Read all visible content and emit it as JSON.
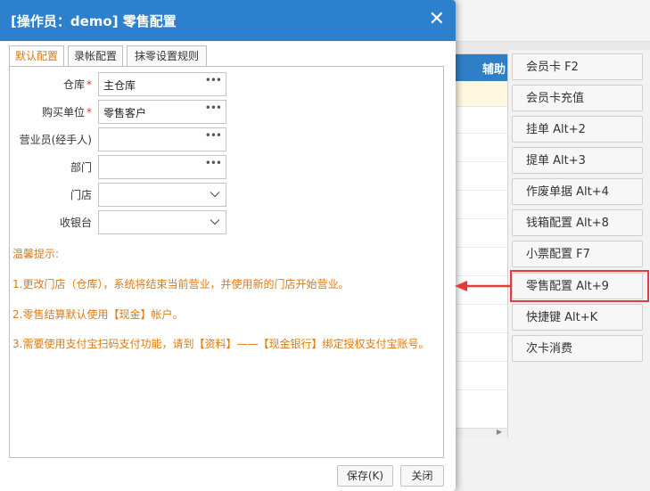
{
  "dialog": {
    "title": "[操作员：demo] 零售配置",
    "close_glyph": "✕",
    "tabs": [
      {
        "label": "默认配置"
      },
      {
        "label": "录帐配置"
      },
      {
        "label": "抹零设置规则"
      }
    ],
    "fields": [
      {
        "label": "仓库",
        "required_mark": "*",
        "value": "主仓库",
        "trigger": "•••"
      },
      {
        "label": "购买单位",
        "required_mark": "*",
        "value": "零售客户",
        "trigger": "•••"
      },
      {
        "label": "营业员(经手人)",
        "value": "",
        "trigger": "•••"
      },
      {
        "label": "部门",
        "value": "",
        "trigger": "•••"
      },
      {
        "label": "门店",
        "value": "",
        "trigger": "chevron-down"
      },
      {
        "label": "收银台",
        "value": "",
        "trigger": "chevron-down"
      }
    ],
    "tips": {
      "heading": "温馨提示:",
      "items": [
        "1.更改门店（仓库），系统将结束当前营业，并使用新的门店开始营业。",
        "2.零售结算默认使用【现金】帐户。",
        "3.需要使用支付宝扫码支付功能，请到【资料】——【现金银行】绑定授权支付宝账号。"
      ]
    },
    "buttons": {
      "save": "保存(K)",
      "close": "关闭"
    }
  },
  "background": {
    "grid_header": "辅助"
  },
  "side_buttons": [
    "会员卡 F2",
    "会员卡充值",
    "挂单 Alt+2",
    "提单 Alt+3",
    "作废单据 Alt+4",
    "钱箱配置 Alt+8",
    "小票配置 F7",
    "零售配置 Alt+9",
    "快捷键 Alt+K",
    "次卡消费"
  ],
  "colors": {
    "title_bar": "#2d80cd",
    "tip_text": "#e07a10",
    "highlight": "#e83a3a",
    "active_tab": "#d67a1a"
  }
}
